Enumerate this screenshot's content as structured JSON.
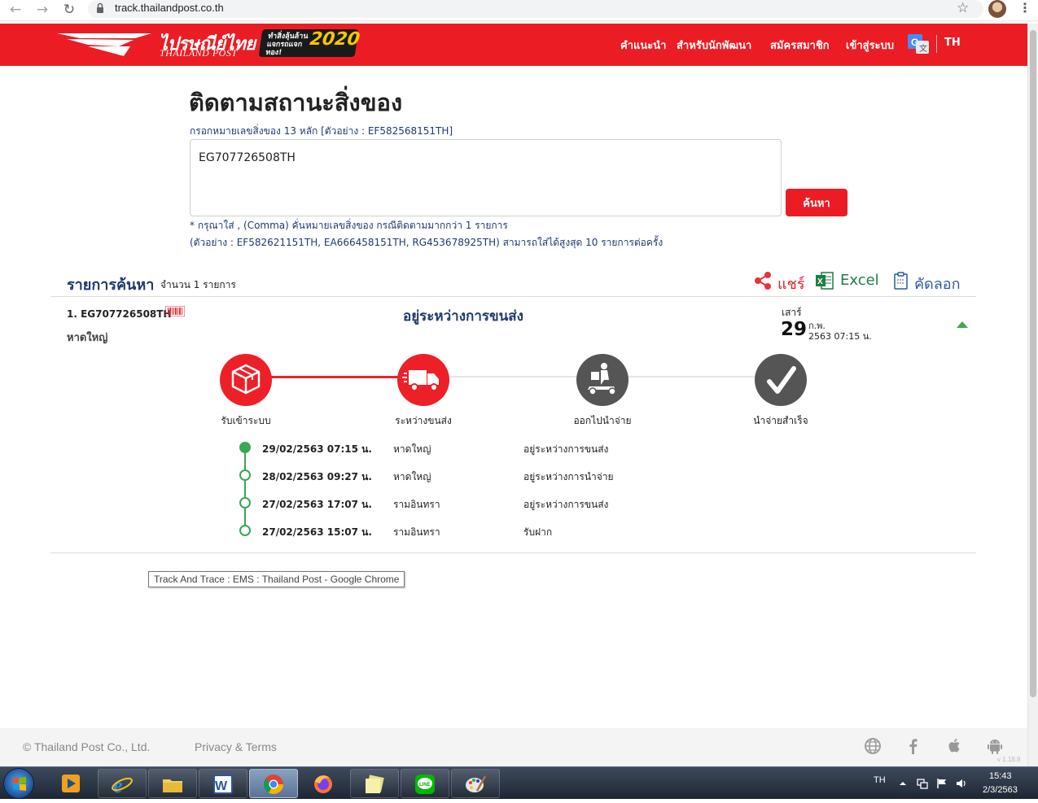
{
  "browser": {
    "url": "track.thailandpost.co.th"
  },
  "header": {
    "logo_th": "ไปรษณีย์ไทย",
    "logo_en": "THAILAND POST",
    "promo_small": "ทำสิ่งลุ้นล้าน แจกรถแจกทอง!",
    "promo_year": "2020",
    "nav": [
      "คำแนะนำ",
      "สำหรับนักพัฒนา",
      "สมัครสมาชิก",
      "เข้าสู่ระบบ"
    ],
    "lang": "TH"
  },
  "search": {
    "title": "ติดตามสถานะสิ่งของ",
    "hint": "กรอกหมายเลขสิ่งของ 13 หลัก [ตัวอย่าง : EF582568151TH]",
    "value": "EG707726508TH",
    "button": "ค้นหา",
    "note1": "* กรุณาใส่ , (Comma) คั่นหมายเลขสิ่งของ กรณีติดตามมากกว่า 1 รายการ",
    "note2": "(ตัวอย่าง : EF582621151TH, EA666458151TH, RG453678925TH) สามารถใส่ได้สูงสุด 10 รายการต่อครั้ง"
  },
  "results": {
    "title": "รายการค้นหา",
    "count": "จำนวน 1 รายการ",
    "share": "แชร์",
    "excel": "Excel",
    "copy": "คัดลอก"
  },
  "item": {
    "number": "1. EG707726508TH",
    "location": "หาดใหญ่",
    "status": "อยู่ระหว่างการขนส่ง",
    "day_name": "เสาร์",
    "day_num": "29",
    "month": "ก.พ.",
    "year_time": "2563 07:15 น.",
    "steps": [
      "รับเข้าระบบ",
      "ระหว่างขนส่ง",
      "ออกไปนำจ่าย",
      "นำจ่ายสำเร็จ"
    ],
    "events": [
      {
        "date": "29/02/2563 07:15 น.",
        "place": "หาดใหญ่",
        "desc": "อยู่ระหว่างการขนส่ง"
      },
      {
        "date": "28/02/2563 09:27 น.",
        "place": "หาดใหญ่",
        "desc": "อยู่ระหว่างการนำจ่าย"
      },
      {
        "date": "27/02/2563 17:07 น.",
        "place": "รามอินทรา",
        "desc": "อยู่ระหว่างการขนส่ง"
      },
      {
        "date": "27/02/2563 15:07 น.",
        "place": "รามอินทรา",
        "desc": "รับฝาก"
      }
    ]
  },
  "tooltip": "Track And Trace : EMS : Thailand Post - Google Chrome",
  "footer": {
    "copyright": "© Thailand Post Co., Ltd.",
    "privacy": "Privacy & Terms",
    "version": "v 1.18.8"
  },
  "taskbar": {
    "lang": "TH",
    "time": "15:43",
    "date": "2/3/2563"
  },
  "colors": {
    "brand_red": "#ec1c24",
    "navy": "#1f3a6e",
    "green": "#3aa853",
    "step_gray": "#555555"
  },
  "icons": [
    "back-icon",
    "forward-icon",
    "reload-icon",
    "lock-icon",
    "star-icon",
    "share-icon",
    "excel-icon",
    "clipboard-icon",
    "barcode-icon",
    "box-icon",
    "truck-icon",
    "courier-icon",
    "check-icon",
    "globe-icon",
    "facebook-icon",
    "apple-icon",
    "android-icon"
  ]
}
